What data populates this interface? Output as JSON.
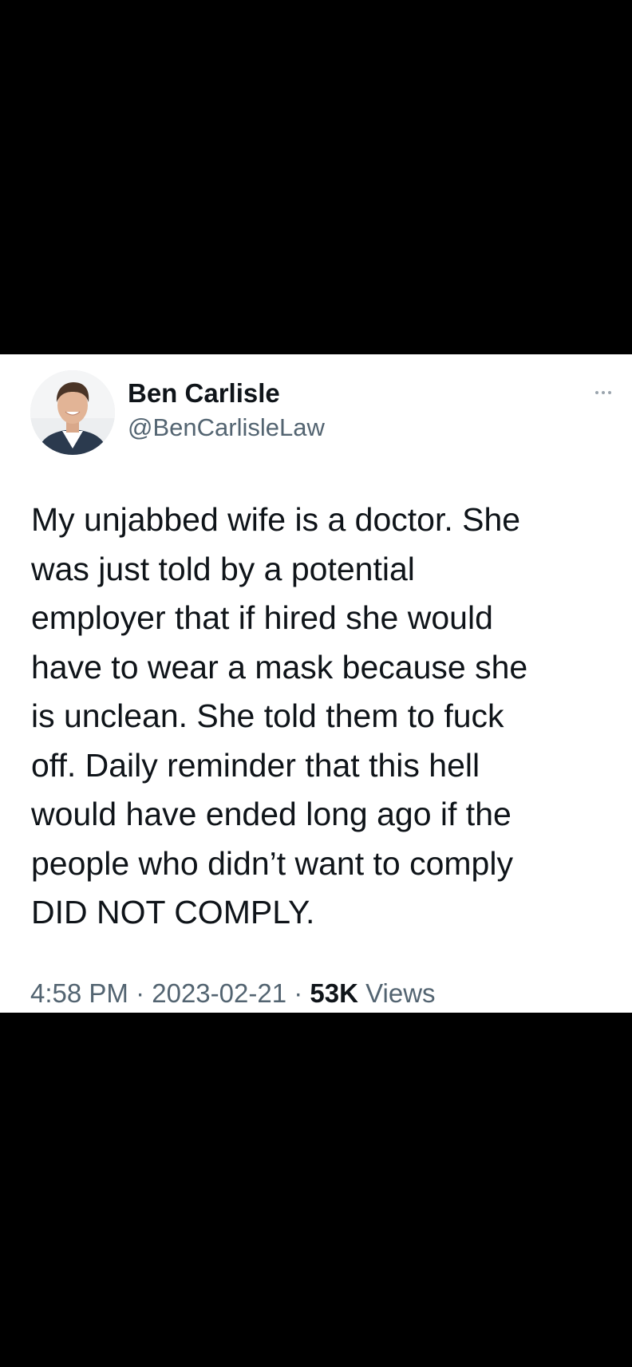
{
  "tweet": {
    "author": {
      "name": "Ben Carlisle",
      "handle": "@BenCarlisleLaw"
    },
    "text": "My unjabbed wife is a doctor. She\nwas just told by a potential\nemployer that if hired she would\nhave to wear a mask because she\nis unclean. She told them to fuck\noff. Daily reminder that this hell\nwould have ended long ago if the\npeople who didn’t want to comply\nDID NOT COMPLY.",
    "time": "4:58 PM",
    "separator": "·",
    "date": "2023-02-21",
    "views_count": "53K",
    "views_label": "Views"
  },
  "icons": {
    "more": "more-horizontal-icon"
  },
  "colors": {
    "background": "#000000",
    "card": "#ffffff",
    "text": "#0f1419",
    "secondary_text": "#536471"
  }
}
